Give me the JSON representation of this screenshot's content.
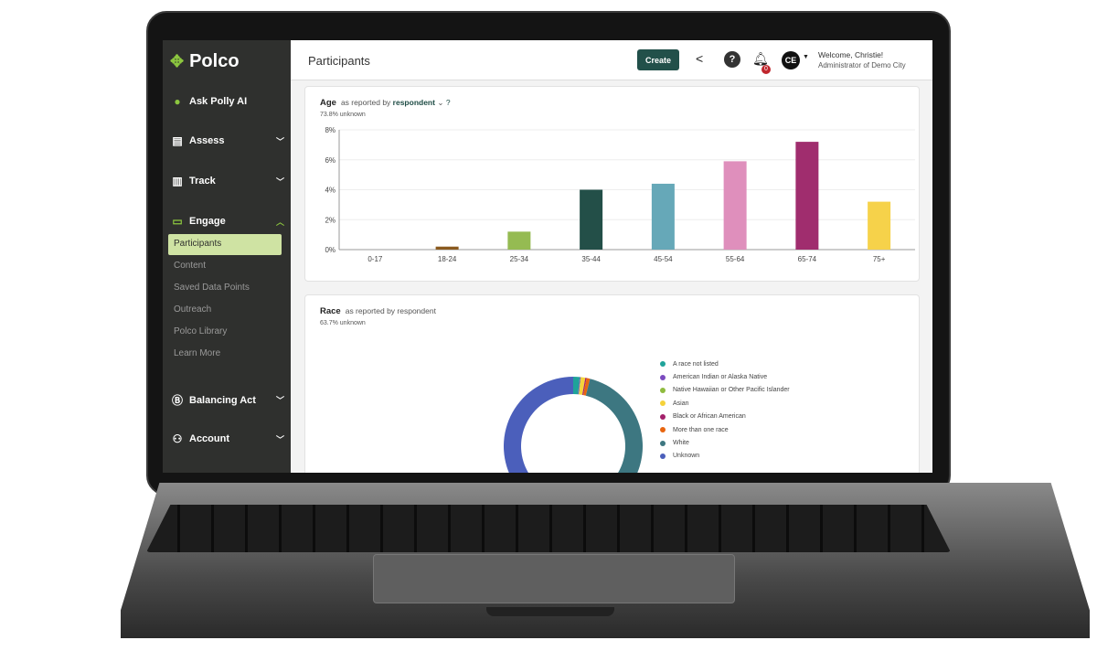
{
  "sidebar": {
    "logo": "Polco",
    "items": [
      {
        "label": "Ask Polly AI",
        "icon": "parrot-icon"
      },
      {
        "label": "Assess",
        "icon": "clipboard-icon"
      },
      {
        "label": "Track",
        "icon": "chart-icon"
      },
      {
        "label": "Engage",
        "icon": "chat-icon"
      },
      {
        "label": "Balancing Act",
        "icon": "b-icon"
      },
      {
        "label": "Account",
        "icon": "user-icon"
      }
    ],
    "engage_sub": [
      "Participants",
      "Content",
      "Saved Data Points",
      "Outreach",
      "Polco Library",
      "Learn More"
    ],
    "active": "Participants"
  },
  "header": {
    "title": "Participants",
    "create_label": "Create",
    "help_label": "?",
    "notifications": "0",
    "avatar": "CE",
    "welcome": "Welcome, Christie!",
    "role": "Administrator of Demo City"
  },
  "age": {
    "title": "Age",
    "qualifier": "as reported by",
    "source": "respondent",
    "unknown": "73.8% unknown"
  },
  "race": {
    "title": "Race",
    "qualifier": "as reported by respondent",
    "unknown": "63.7% unknown"
  },
  "chart_data": [
    {
      "type": "bar",
      "categories": [
        "0-17",
        "18-24",
        "25-34",
        "35-44",
        "45-54",
        "55-64",
        "65-74",
        "75+"
      ],
      "values": [
        0,
        0.2,
        1.2,
        4.0,
        4.4,
        5.9,
        7.2,
        3.2
      ],
      "colors": [
        "#999999",
        "#8a5a1e",
        "#95bb52",
        "#234f48",
        "#66a8b8",
        "#df8fbc",
        "#a02d6e",
        "#f6d24a"
      ],
      "ylim": [
        0,
        8
      ],
      "yticks": [
        "0%",
        "2%",
        "4%",
        "6%",
        "8%"
      ],
      "grid": true
    },
    {
      "type": "pie",
      "donut": true,
      "legend": "right",
      "categories": [
        "A race not listed",
        "American Indian or Alaska Native",
        "Native Hawaiian or Other Pacific Islander",
        "Asian",
        "Black or African American",
        "More than one race",
        "White",
        "Unknown"
      ],
      "values": [
        1.5,
        0.2,
        0.1,
        1.0,
        0.3,
        0.8,
        32.4,
        63.7
      ],
      "colors": [
        "#1fa39a",
        "#7b4bbf",
        "#8fbb3f",
        "#f5d23a",
        "#a3206a",
        "#e8650f",
        "#3d7781",
        "#4b5fbb"
      ]
    }
  ]
}
